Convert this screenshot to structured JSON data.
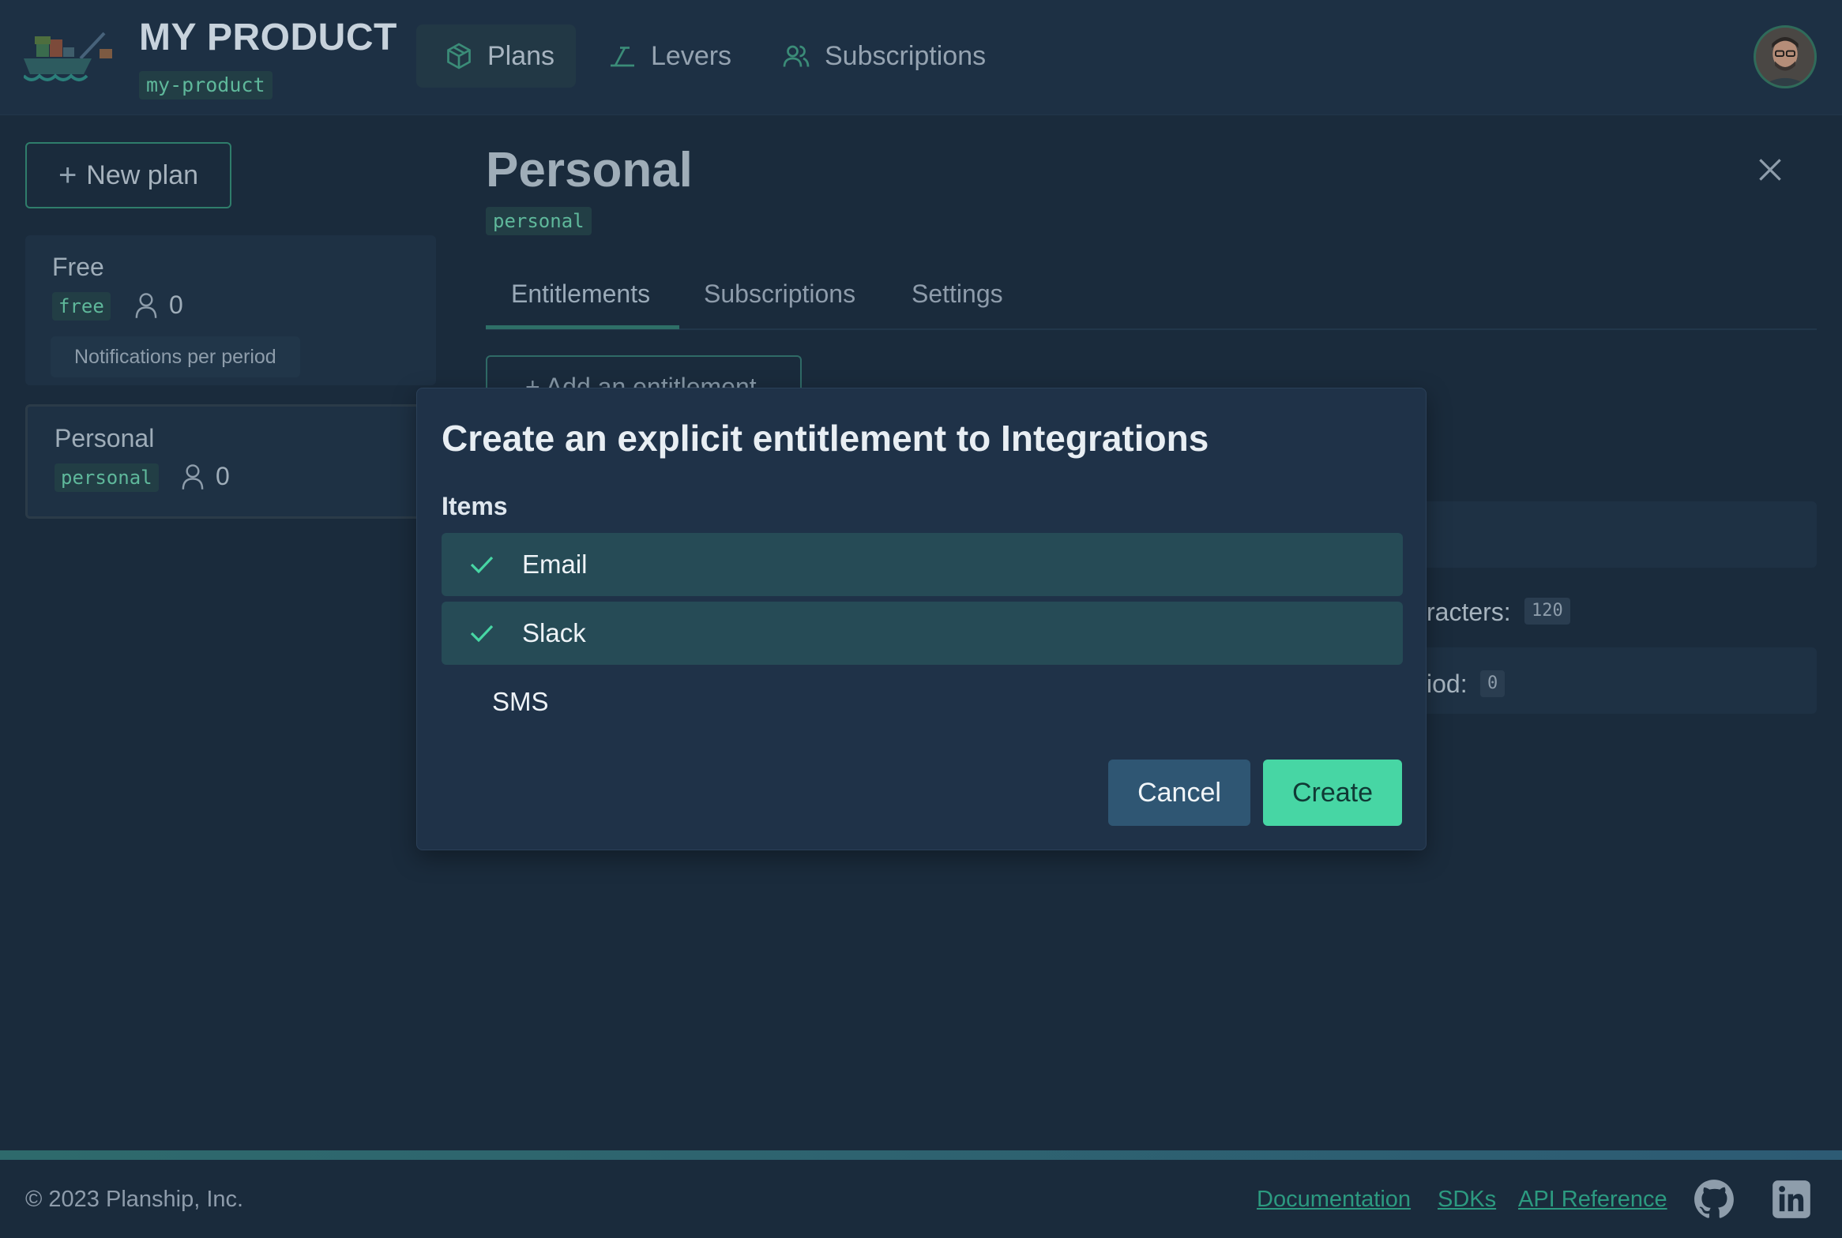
{
  "header": {
    "brand_title": "MY PRODUCT",
    "brand_slug": "my-product",
    "nav": [
      {
        "label": "Plans",
        "icon": "cube-icon",
        "active": true
      },
      {
        "label": "Levers",
        "icon": "lever-icon",
        "active": false
      },
      {
        "label": "Subscriptions",
        "icon": "users-icon",
        "active": false
      }
    ]
  },
  "sidebar": {
    "new_plan_label": "New plan",
    "plans": [
      {
        "name": "Free",
        "slug": "free",
        "subscribers": "0",
        "features": [
          "Notifications per period"
        ]
      },
      {
        "name": "Personal",
        "slug": "personal",
        "subscribers": "0"
      }
    ]
  },
  "main": {
    "title": "Personal",
    "slug": "personal",
    "tabs": [
      "Entitlements",
      "Subscriptions",
      "Settings"
    ],
    "add_entitlement_label": "+ Add an entitlement",
    "background_rows": [
      {
        "text": "racters:",
        "value": "120"
      },
      {
        "text": "iod:",
        "value": "0"
      }
    ]
  },
  "modal": {
    "title": "Create an explicit entitlement to Integrations",
    "items_label": "Items",
    "options": [
      {
        "label": "Email",
        "selected": true
      },
      {
        "label": "Slack",
        "selected": true
      },
      {
        "label": "SMS",
        "selected": false
      }
    ],
    "cancel_label": "Cancel",
    "create_label": "Create"
  },
  "footer": {
    "copyright": "© 2023 Planship, Inc.",
    "links": [
      "Documentation",
      "SDKs",
      "API Reference"
    ]
  },
  "colors": {
    "accent": "#47d6a4",
    "background": "#1a2b3c",
    "modal": "#1f3248",
    "selected_option": "#264b56"
  }
}
